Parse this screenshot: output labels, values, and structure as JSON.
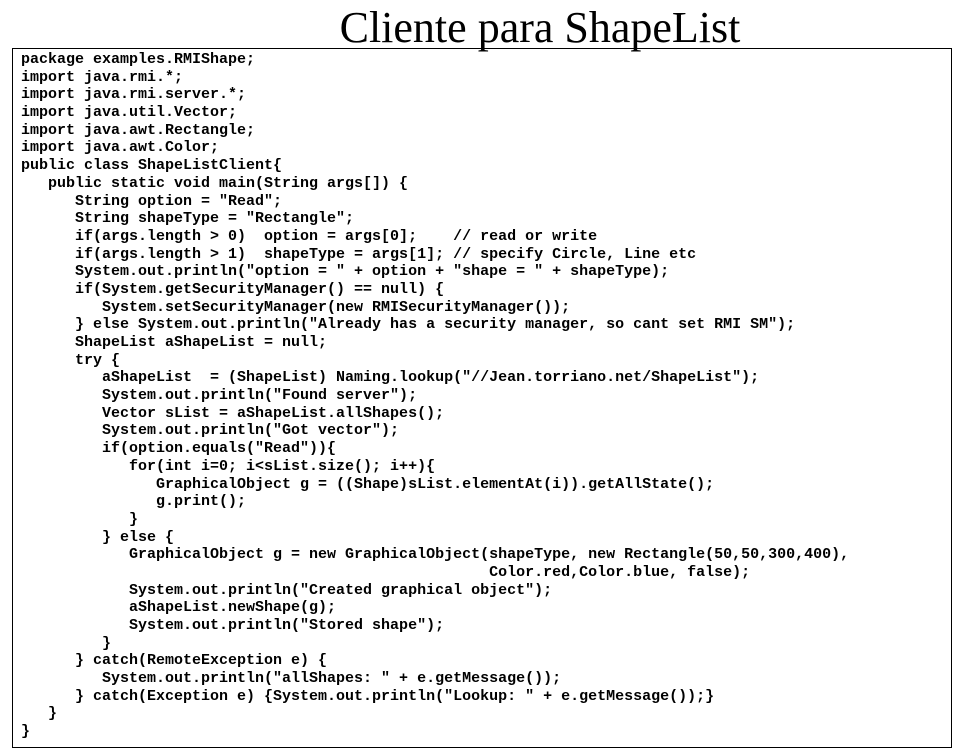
{
  "title": "Cliente para ShapeList",
  "code": {
    "l1": "package examples.RMIShape;",
    "l2": "import java.rmi.*;",
    "l3": "import java.rmi.server.*;",
    "l4": "import java.util.Vector;",
    "l5": "import java.awt.Rectangle;",
    "l6": "import java.awt.Color;",
    "l7": "",
    "l8": "public class ShapeListClient{",
    "l9": "   public static void main(String args[]) {",
    "l10": "      String option = \"Read\";",
    "l11": "      String shapeType = \"Rectangle\";",
    "l12": "      if(args.length > 0)  option = args[0];    // read or write",
    "l13": "      if(args.length > 1)  shapeType = args[1]; // specify Circle, Line etc",
    "l14": "      System.out.println(\"option = \" + option + \"shape = \" + shapeType);",
    "l15": "      if(System.getSecurityManager() == null) {",
    "l16": "         System.setSecurityManager(new RMISecurityManager());",
    "l17": "      } else System.out.println(\"Already has a security manager, so cant set RMI SM\");",
    "l18": "      ShapeList aShapeList = null;",
    "l19": "      try {",
    "l20": "         aShapeList  = (ShapeList) Naming.lookup(\"//Jean.torriano.net/ShapeList\");",
    "l21": "         System.out.println(\"Found server\");",
    "l22": "         Vector sList = aShapeList.allShapes();",
    "l23": "         System.out.println(\"Got vector\");",
    "l24": "         if(option.equals(\"Read\")){",
    "l25": "            for(int i=0; i<sList.size(); i++){",
    "l26": "               GraphicalObject g = ((Shape)sList.elementAt(i)).getAllState();",
    "l27": "               g.print();",
    "l28": "            }",
    "l29": "         } else {",
    "l30": "            GraphicalObject g = new GraphicalObject(shapeType, new Rectangle(50,50,300,400),",
    "l31": "                                                    Color.red,Color.blue, false);",
    "l32": "            System.out.println(\"Created graphical object\");",
    "l33": "            aShapeList.newShape(g);",
    "l34": "            System.out.println(\"Stored shape\");",
    "l35": "         }",
    "l36": "      } catch(RemoteException e) {",
    "l37": "         System.out.println(\"allShapes: \" + e.getMessage());",
    "l38": "      } catch(Exception e) {System.out.println(\"Lookup: \" + e.getMessage());}",
    "l39": "   }",
    "l40": "}"
  }
}
